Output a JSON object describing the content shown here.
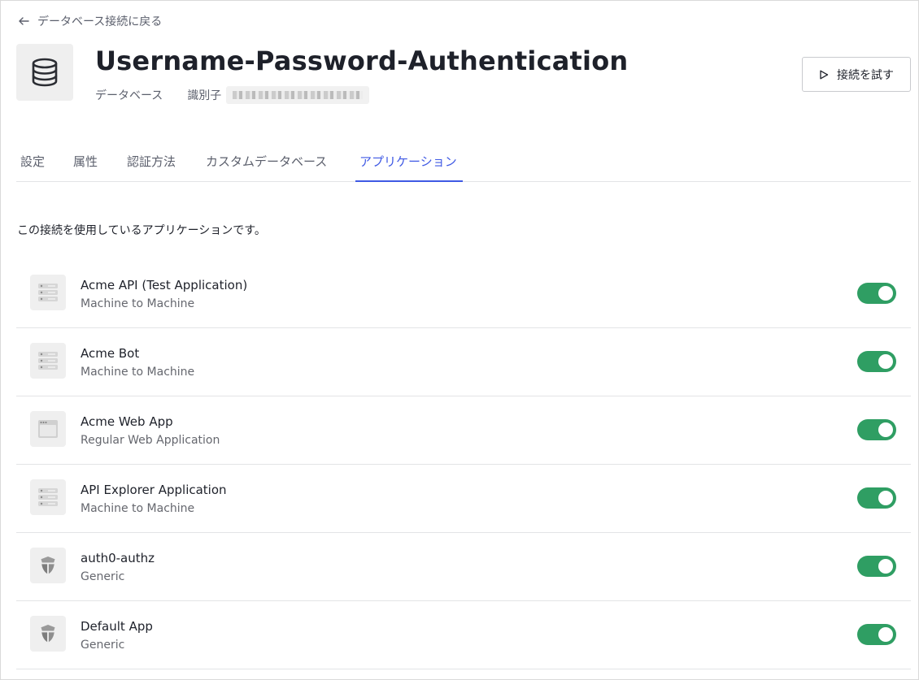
{
  "header": {
    "back_label": "データベース接続に戻る",
    "title": "Username-Password-Authentication",
    "type_label": "データベース",
    "identifier_label": "識別子",
    "try_button_label": "接続を試す"
  },
  "tabs": [
    {
      "label": "設定",
      "active": false
    },
    {
      "label": "属性",
      "active": false
    },
    {
      "label": "認証方法",
      "active": false
    },
    {
      "label": "カスタムデータベース",
      "active": false
    },
    {
      "label": "アプリケーション",
      "active": true
    }
  ],
  "intro_text": "この接続を使用しているアプリケーションです。",
  "applications": [
    {
      "name": "Acme API (Test Application)",
      "type": "Machine to Machine",
      "icon": "server-icon",
      "enabled": true
    },
    {
      "name": "Acme Bot",
      "type": "Machine to Machine",
      "icon": "server-icon",
      "enabled": true
    },
    {
      "name": "Acme Web App",
      "type": "Regular Web Application",
      "icon": "browser-window-icon",
      "enabled": true
    },
    {
      "name": "API Explorer Application",
      "type": "Machine to Machine",
      "icon": "server-icon",
      "enabled": true
    },
    {
      "name": "auth0-authz",
      "type": "Generic",
      "icon": "auth0-shield-icon",
      "enabled": true
    },
    {
      "name": "Default App",
      "type": "Generic",
      "icon": "auth0-shield-icon",
      "enabled": true
    }
  ],
  "colors": {
    "accent": "#3f59e4",
    "toggle_on": "#2f9e63",
    "text_primary": "#1e212a",
    "text_secondary": "#5b5f6c"
  }
}
